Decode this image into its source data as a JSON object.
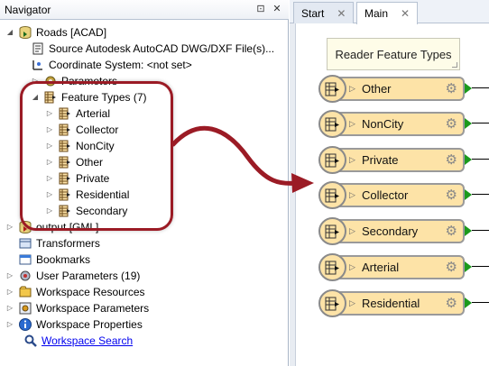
{
  "navigator": {
    "title": "Navigator",
    "pin_glyph": "⊡",
    "close_glyph": "✕",
    "items": [
      {
        "label": "Roads [ACAD]",
        "expander": "◢",
        "icon": "dataset-reader-icon"
      },
      {
        "label": "Source Autodesk AutoCAD DWG/DXF File(s)...",
        "expander": "",
        "icon": "source-file-icon"
      },
      {
        "label": "Coordinate System: <not set>",
        "expander": "",
        "icon": "coordinate-system-icon"
      },
      {
        "label": "Parameters",
        "expander": "▷",
        "icon": "parameters-icon"
      },
      {
        "label": "Feature Types (7)",
        "expander": "◢",
        "icon": "feature-types-icon"
      },
      {
        "label": "Arterial",
        "expander": "▷",
        "icon": "feature-type-icon"
      },
      {
        "label": "Collector",
        "expander": "▷",
        "icon": "feature-type-icon"
      },
      {
        "label": "NonCity",
        "expander": "▷",
        "icon": "feature-type-icon"
      },
      {
        "label": "Other",
        "expander": "▷",
        "icon": "feature-type-icon"
      },
      {
        "label": "Private",
        "expander": "▷",
        "icon": "feature-type-icon"
      },
      {
        "label": "Residential",
        "expander": "▷",
        "icon": "feature-type-icon"
      },
      {
        "label": "Secondary",
        "expander": "▷",
        "icon": "feature-type-icon"
      },
      {
        "label": "output [GML]",
        "expander": "▷",
        "icon": "dataset-writer-icon"
      },
      {
        "label": "Transformers",
        "expander": "",
        "icon": "transformers-icon"
      },
      {
        "label": "Bookmarks",
        "expander": "",
        "icon": "bookmarks-icon"
      },
      {
        "label": "User Parameters (19)",
        "expander": "▷",
        "icon": "user-parameters-icon"
      },
      {
        "label": "Workspace Resources",
        "expander": "▷",
        "icon": "workspace-resources-icon"
      },
      {
        "label": "Workspace Parameters",
        "expander": "▷",
        "icon": "workspace-parameters-icon"
      },
      {
        "label": "Workspace Properties",
        "expander": "▷",
        "icon": "workspace-properties-icon"
      },
      {
        "label": "Workspace Search",
        "expander": "",
        "icon": "search-icon"
      }
    ]
  },
  "tabs": [
    {
      "label": "Start",
      "close": "✕"
    },
    {
      "label": "Main",
      "close": "✕"
    }
  ],
  "reader_feature_types_label": "Reader Feature Types",
  "feature_types": [
    {
      "name": "Other",
      "chevron": "▷",
      "gear": "⚙"
    },
    {
      "name": "NonCity",
      "chevron": "▷",
      "gear": "⚙"
    },
    {
      "name": "Private",
      "chevron": "▷",
      "gear": "⚙"
    },
    {
      "name": "Collector",
      "chevron": "▷",
      "gear": "⚙"
    },
    {
      "name": "Secondary",
      "chevron": "▷",
      "gear": "⚙"
    },
    {
      "name": "Arterial",
      "chevron": "▷",
      "gear": "⚙"
    },
    {
      "name": "Residential",
      "chevron": "▷",
      "gear": "⚙"
    }
  ],
  "colors": {
    "annotation": "#9b1b25",
    "feature_fill": "#fde3a7",
    "output_port": "#1c9a1c",
    "link": "#0000ee"
  }
}
